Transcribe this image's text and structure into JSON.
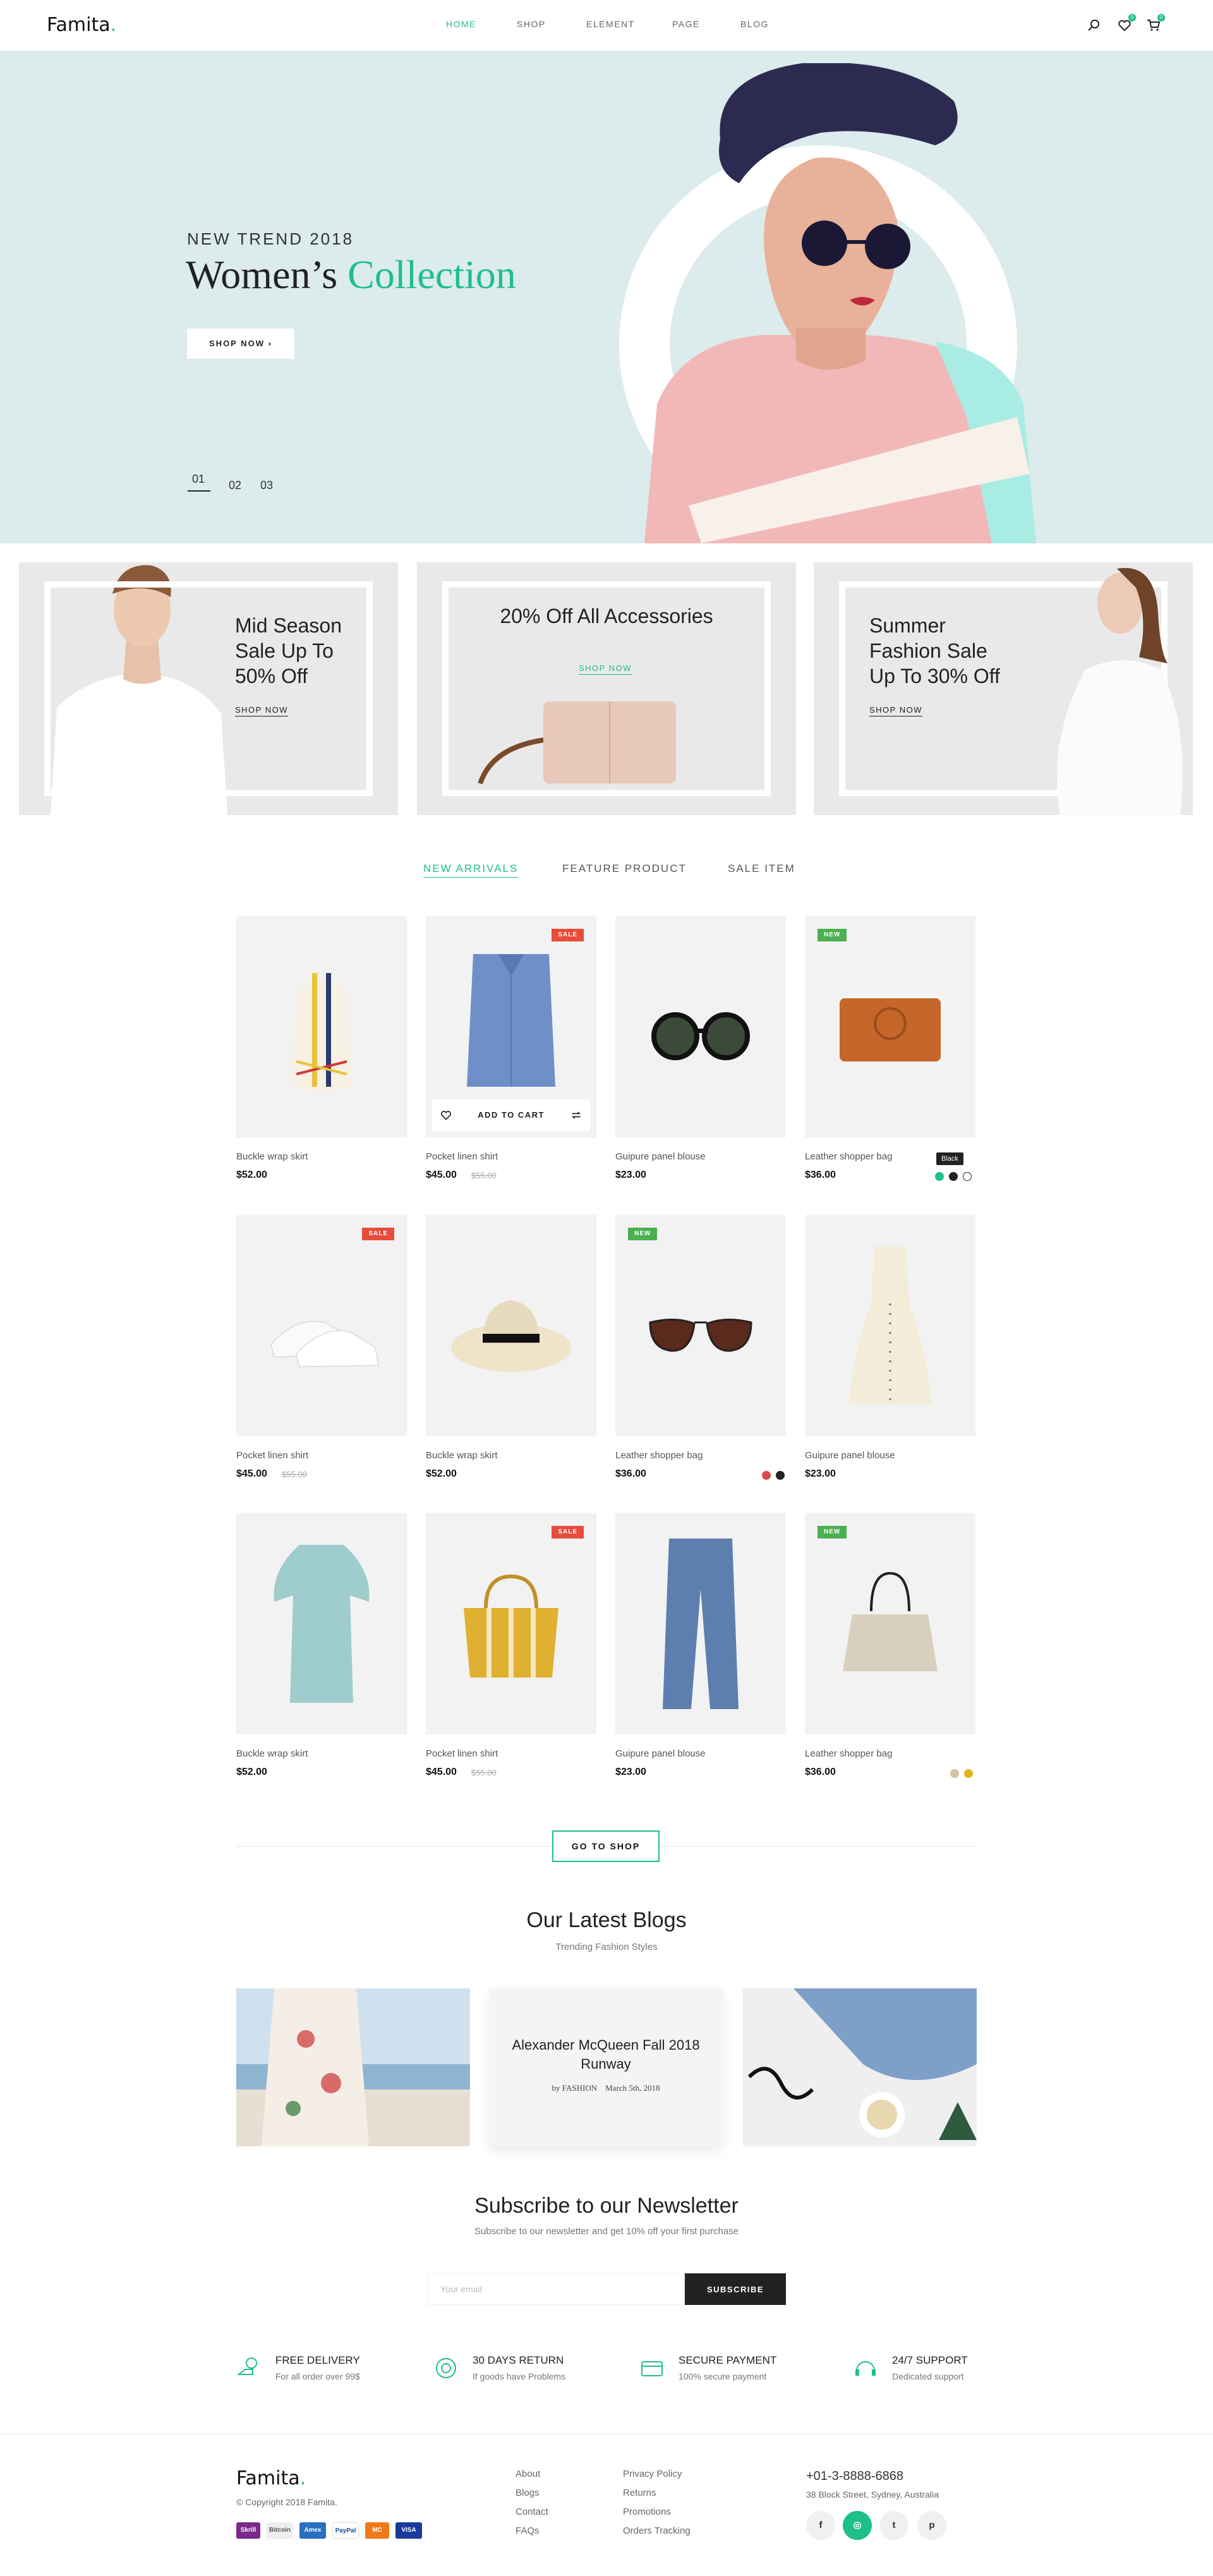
{
  "header": {
    "logo": "Famita",
    "logo_dot": ".",
    "nav": [
      {
        "label": "HOME",
        "active": true
      },
      {
        "label": "SHOP",
        "active": false
      },
      {
        "label": "ELEMENT",
        "active": false
      },
      {
        "label": "PAGE",
        "active": false
      },
      {
        "label": "BLOG",
        "active": false
      }
    ],
    "wishlist_count": "0",
    "cart_count": "0"
  },
  "hero": {
    "subtitle": "NEW TREND 2018",
    "title_main": "Women’s",
    "title_accent": "Collection",
    "button": "SHOP NOW",
    "button_arrow": "›",
    "slides": [
      "01",
      "02",
      "03"
    ]
  },
  "banners": [
    {
      "text": "Mid Season Sale Up To 50% Off",
      "link": "SHOP NOW"
    },
    {
      "text": "20% Off All Accessories",
      "link": "SHOP NOW"
    },
    {
      "text": "Summer Fashion Sale Up To 30% Off",
      "link": "SHOP NOW"
    }
  ],
  "tabs": [
    "NEW ARRIVALS",
    "FEATURE PRODUCT",
    "SALE ITEM"
  ],
  "products": [
    {
      "name": "Buckle wrap skirt",
      "price": "$52.00"
    },
    {
      "name": "Pocket linen shirt",
      "price": "$45.00",
      "old_price": "$55.00",
      "tag": "SALE",
      "add_to_cart": "ADD TO CART"
    },
    {
      "name": "Guipure panel blouse",
      "price": "$23.00"
    },
    {
      "name": "Leather shopper bag",
      "price": "$36.00",
      "tag": "NEW",
      "tooltip": "Black"
    },
    {
      "name": "Pocket linen shirt",
      "price": "$45.00",
      "old_price": "$55.00",
      "tag": "SALE"
    },
    {
      "name": "Buckle wrap skirt",
      "price": "$52.00"
    },
    {
      "name": "Leather shopper bag",
      "price": "$36.00",
      "tag": "NEW"
    },
    {
      "name": "Guipure panel blouse",
      "price": "$23.00"
    },
    {
      "name": "Buckle wrap skirt",
      "price": "$52.00"
    },
    {
      "name": "Pocket linen shirt",
      "price": "$45.00",
      "old_price": "$55.00",
      "tag": "SALE"
    },
    {
      "name": "Guipure panel blouse",
      "price": "$23.00"
    },
    {
      "name": "Leather shopper bag",
      "price": "$36.00",
      "tag": "NEW"
    }
  ],
  "go_to_shop": "GO TO SHOP",
  "blogs": {
    "title": "Our Latest Blogs",
    "subtitle": "Trending Fashion Styles",
    "featured_title": "Alexander McQueen Fall 2018 Runway",
    "featured_author": "by FASHION",
    "featured_date": "March 5th, 2018"
  },
  "newsletter": {
    "title": "Subscribe to our Newsletter",
    "subtitle": "Subscribe to our newsletter and get 10% off your first purchase",
    "placeholder": "Your email",
    "button": "SUBSCRIBE"
  },
  "features": [
    {
      "title": "FREE DELIVERY",
      "subtitle": "For all order over 99$"
    },
    {
      "title": "30 DAYS RETURN",
      "subtitle": "If goods have Problems"
    },
    {
      "title": "SECURE PAYMENT",
      "subtitle": "100% secure payment"
    },
    {
      "title": "24/7 SUPPORT",
      "subtitle": "Dedicated support"
    }
  ],
  "footer": {
    "logo": "Famita",
    "logo_dot": ".",
    "copyright": "© Copyright 2018 Famita.",
    "payments": [
      "Skrill",
      "Bitcoin",
      "Amex",
      "PayPal",
      "MC",
      "VISA"
    ],
    "links_col1": [
      "About",
      "Blogs",
      "Contact",
      "FAQs"
    ],
    "links_col2": [
      "Privacy Policy",
      "Returns",
      "Promotions",
      "Orders Tracking"
    ],
    "phone": "+01-3-8888-6868",
    "address": "38 Block Street, Sydney, Australia",
    "social": [
      "f",
      "◎",
      "t",
      "p"
    ]
  },
  "colors": {
    "accent": "#1dbf8a",
    "sale": "#e74c3c",
    "new": "#4caf50"
  }
}
